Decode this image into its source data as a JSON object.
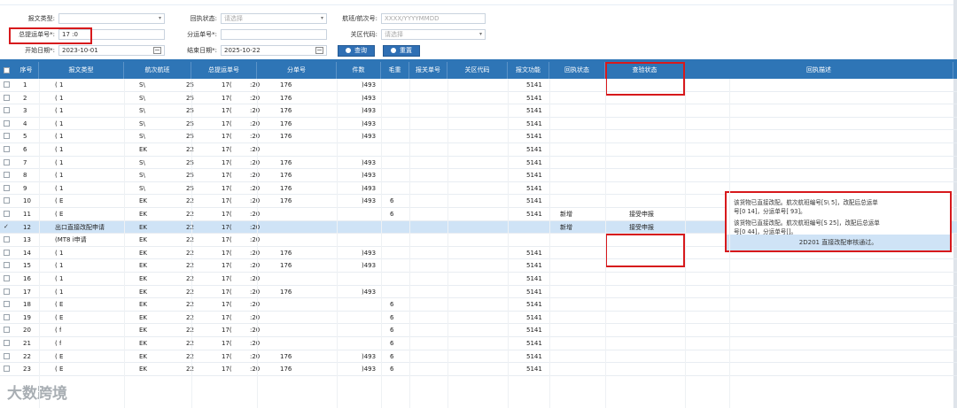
{
  "filters": {
    "msg_type_label": "报文类型:",
    "receipt_status_label": "回执状态:",
    "receipt_status_placeholder": "请选择",
    "voyage_label": "航班/航次号:",
    "voyage_placeholder": "XXXX/YYYYMMDD",
    "master_bill_label": "总提运单号*:",
    "master_bill_value": "17                  :0",
    "house_bill_label": "分运单号*:",
    "customs_label": "关区代码:",
    "customs_placeholder": "请选择",
    "start_label": "开始日期*:",
    "start_value": "2023-10-01",
    "end_label": "结束日期*:",
    "end_value": "2025-10-22",
    "search_btn": "查询",
    "reset_btn": "重置"
  },
  "columns": [
    "序号",
    "报文类型",
    "航次航班",
    "总提运单号",
    "分单号",
    "件数",
    "毛重",
    "报关单号",
    "关区代码",
    "报文功能",
    "回执状态",
    "查验状态",
    "回执描述"
  ],
  "rows": [
    {
      "no": "1",
      "type": "(               1",
      "voy": "S\\",
      "voy2": "25",
      "bill": "17(",
      "bill2": ":20",
      "sub": "176",
      "sub2": ")493",
      "pcs": "",
      "customs": "5141",
      "func": "",
      "status": ""
    },
    {
      "no": "2",
      "type": "(               1",
      "voy": "S\\",
      "voy2": "25",
      "bill": "17(",
      "bill2": ":20",
      "sub": "176",
      "sub2": ")493",
      "pcs": "",
      "customs": "5141",
      "func": "",
      "status": ""
    },
    {
      "no": "3",
      "type": "(               1",
      "voy": "S\\",
      "voy2": "25",
      "bill": "17(",
      "bill2": ":20",
      "sub": "176",
      "sub2": ")493",
      "pcs": "",
      "customs": "5141",
      "func": "",
      "status": ""
    },
    {
      "no": "4",
      "type": "(               1",
      "voy": "S\\",
      "voy2": "25",
      "bill": "17(",
      "bill2": ":20",
      "sub": "176",
      "sub2": ")493",
      "pcs": "",
      "customs": "5141",
      "func": "",
      "status": ""
    },
    {
      "no": "5",
      "type": "(               1",
      "voy": "S\\",
      "voy2": "25",
      "bill": "17(",
      "bill2": ":20",
      "sub": "176",
      "sub2": ")493",
      "pcs": "",
      "customs": "5141",
      "func": "",
      "status": ""
    },
    {
      "no": "6",
      "type": "(               1",
      "voy": "EK",
      "voy2": "22",
      "bill": "17(",
      "bill2": ":20",
      "sub": "",
      "sub2": "",
      "pcs": "",
      "customs": "5141",
      "func": "",
      "status": ""
    },
    {
      "no": "7",
      "type": "(               1",
      "voy": "S\\",
      "voy2": "25",
      "bill": "17(",
      "bill2": ":20",
      "sub": "176",
      "sub2": ")493",
      "pcs": "",
      "customs": "5141",
      "func": "",
      "status": ""
    },
    {
      "no": "8",
      "type": "(               1",
      "voy": "S\\",
      "voy2": "25",
      "bill": "17(",
      "bill2": ":20",
      "sub": "176",
      "sub2": ")493",
      "pcs": "",
      "customs": "5141",
      "func": "",
      "status": ""
    },
    {
      "no": "9",
      "type": "(               1",
      "voy": "S\\",
      "voy2": "25",
      "bill": "17(",
      "bill2": ":20",
      "sub": "176",
      "sub2": ")493",
      "pcs": "",
      "customs": "5141",
      "func": "",
      "status": ""
    },
    {
      "no": "10",
      "type": "(               E",
      "voy": "EK",
      "voy2": "22",
      "bill": "17(",
      "bill2": ":20",
      "sub": "176",
      "sub2": ")493",
      "pcs": "6",
      "customs": "5141",
      "func": "",
      "status": ""
    },
    {
      "no": "11",
      "type": "(               E",
      "voy": "EK",
      "voy2": "22",
      "bill": "17(",
      "bill2": ":20",
      "sub": "",
      "sub2": "",
      "pcs": "6",
      "customs": "5141",
      "func": "新增",
      "status": "接受申报"
    },
    {
      "no": "12",
      "type": "        出口直接改配申请",
      "voy": "EK",
      "voy2": "22",
      "bill": "17(",
      "bill2": ":20",
      "sub": "",
      "sub2": "",
      "pcs": "",
      "customs": "",
      "func": "新增",
      "status": "接受申报"
    },
    {
      "no": "13",
      "type": "(MT8              i申请",
      "voy": "EK",
      "voy2": "22",
      "bill": "17(",
      "bill2": ":20",
      "sub": "",
      "sub2": "",
      "pcs": "",
      "customs": "",
      "func": "",
      "status": ""
    },
    {
      "no": "14",
      "type": "(               1",
      "voy": "EK",
      "voy2": "22",
      "bill": "17(",
      "bill2": ":20",
      "sub": "176",
      "sub2": ")493",
      "pcs": "",
      "customs": "5141",
      "func": "",
      "status": ""
    },
    {
      "no": "15",
      "type": "(               1",
      "voy": "EK",
      "voy2": "22",
      "bill": "17(",
      "bill2": ":20",
      "sub": "176",
      "sub2": ")493",
      "pcs": "",
      "customs": "5141",
      "func": "",
      "status": ""
    },
    {
      "no": "16",
      "type": "(               1",
      "voy": "EK",
      "voy2": "22",
      "bill": "17(",
      "bill2": ":20",
      "sub": "",
      "sub2": "",
      "pcs": "",
      "customs": "5141",
      "func": "",
      "status": ""
    },
    {
      "no": "17",
      "type": "(               1",
      "voy": "EK",
      "voy2": "22",
      "bill": "17(",
      "bill2": ":20",
      "sub": "176",
      "sub2": ")493",
      "pcs": "",
      "customs": "5141",
      "func": "",
      "status": ""
    },
    {
      "no": "18",
      "type": "(               E",
      "voy": "EK",
      "voy2": "22",
      "bill": "17(",
      "bill2": ":20",
      "sub": "",
      "sub2": "",
      "pcs": "6",
      "customs": "5141",
      "func": "",
      "status": ""
    },
    {
      "no": "19",
      "type": "(               E",
      "voy": "EK",
      "voy2": "22",
      "bill": "17(",
      "bill2": ":20",
      "sub": "",
      "sub2": "",
      "pcs": "6",
      "customs": "5141",
      "func": "",
      "status": ""
    },
    {
      "no": "20",
      "type": "(               f",
      "voy": "EK",
      "voy2": "22",
      "bill": "17(",
      "bill2": ":20",
      "sub": "",
      "sub2": "",
      "pcs": "6",
      "customs": "5141",
      "func": "",
      "status": ""
    },
    {
      "no": "21",
      "type": "(               f",
      "voy": "EK",
      "voy2": "22",
      "bill": "17(",
      "bill2": ":20",
      "sub": "",
      "sub2": "",
      "pcs": "6",
      "customs": "5141",
      "func": "",
      "status": ""
    },
    {
      "no": "22",
      "type": "(               E",
      "voy": "EK",
      "voy2": "22",
      "bill": "17(",
      "bill2": ":20",
      "sub": "176",
      "sub2": ")493",
      "pcs": "6",
      "customs": "5141",
      "func": "",
      "status": ""
    },
    {
      "no": "23",
      "type": "(               E",
      "voy": "EK",
      "voy2": "22",
      "bill": "17(",
      "bill2": ":20",
      "sub": "176",
      "sub2": ")493",
      "pcs": "6",
      "customs": "5141",
      "func": "",
      "status": ""
    }
  ],
  "popup": {
    "line1": "该货物已直接改配。航次航班编号[S\\                    5]，改配后总运单",
    "line2": "号[0                    14]，分运单号[                        93]。",
    "line3": "该货物已直接改配。航次航班编号[S                    25]，改配后总运单",
    "line4": "号[0                    44]，分运单号[]。",
    "ok": "2D201 直接改配审核通过。"
  },
  "watermark": "大数跨境"
}
